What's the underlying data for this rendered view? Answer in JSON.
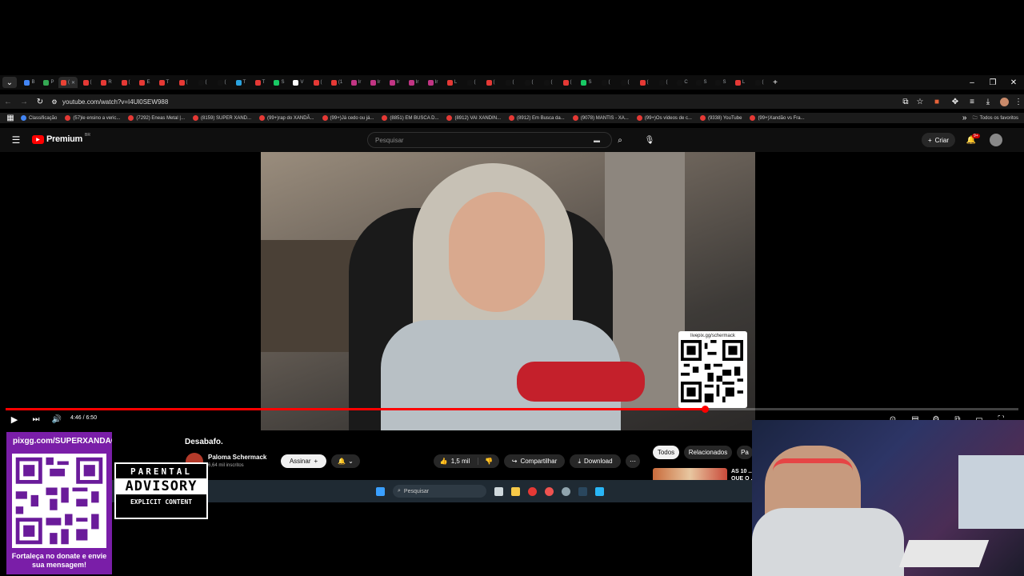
{
  "tabs": [
    {
      "title": "B",
      "color": "#4285f4"
    },
    {
      "title": "P",
      "color": "#34a853"
    },
    {
      "title": "(",
      "color": "#ea4335",
      "active": true
    },
    {
      "title": "(",
      "color": "#e53935"
    },
    {
      "title": "R",
      "color": "#e53935"
    },
    {
      "title": "(",
      "color": "#e53935"
    },
    {
      "title": "E",
      "color": "#e53935"
    },
    {
      "title": "T",
      "color": "#e53935"
    },
    {
      "title": "(",
      "color": "#e53935"
    },
    {
      "title": "(",
      "color": "#111"
    },
    {
      "title": "(",
      "color": "#111"
    },
    {
      "title": "T",
      "color": "#2aa3e0"
    },
    {
      "title": "T",
      "color": "#e53935"
    },
    {
      "title": "S",
      "color": "#18c964"
    },
    {
      "title": "V",
      "color": "#fff"
    },
    {
      "title": "(",
      "color": "#e53935"
    },
    {
      "title": "(1",
      "color": "#e53935"
    },
    {
      "title": "Ir",
      "color": "#c13584"
    },
    {
      "title": "Ir",
      "color": "#c13584"
    },
    {
      "title": "Ir",
      "color": "#c13584"
    },
    {
      "title": "Ir",
      "color": "#c13584"
    },
    {
      "title": "Ir",
      "color": "#c13584"
    },
    {
      "title": "L",
      "color": "#e53935"
    },
    {
      "title": "(",
      "color": "#111"
    },
    {
      "title": "(",
      "color": "#e53935"
    },
    {
      "title": "(",
      "color": "#111"
    },
    {
      "title": "(",
      "color": "#111"
    },
    {
      "title": "(",
      "color": "#111"
    },
    {
      "title": "(",
      "color": "#e53935"
    },
    {
      "title": "S",
      "color": "#18c964"
    },
    {
      "title": "(",
      "color": "#111"
    },
    {
      "title": "(",
      "color": "#111"
    },
    {
      "title": "(",
      "color": "#e53935"
    },
    {
      "title": "(",
      "color": "#111"
    },
    {
      "title": "C",
      "color": "#111"
    },
    {
      "title": "S",
      "color": "#111"
    },
    {
      "title": "S",
      "color": "#111"
    },
    {
      "title": "L",
      "color": "#e53935"
    },
    {
      "title": "(",
      "color": "#111"
    }
  ],
  "address": {
    "url": "youtube.com/watch?v=I4Ul0SEW988"
  },
  "bookmarks": [
    "Classificação",
    "(57)le ensino a veric...",
    "(7292) Eneas Metal |...",
    "(8159) SUPER XAND...",
    "(99+)rap do XANDÃ...",
    "(99+)Já cedo ou já...",
    "(8851) EM BUSCA D...",
    "(8912) VAI XANDIN...",
    "(8912) Em Busca da...",
    "(9078) MANTIS - XA...",
    "(99+)Os vídeos de c...",
    "(9338) YouTube",
    "(99+)Xandão vs Fra..."
  ],
  "bookmarks_all": "Todos os favoritos",
  "youtube": {
    "logo": "Premium",
    "region": "BR",
    "search_placeholder": "Pesquisar",
    "create": "Criar",
    "notif_count": "9+"
  },
  "video": {
    "qr_label": "livepix.gg/schermack",
    "time": "4:46 / 6:50",
    "progress": 0.69
  },
  "meta": {
    "title": "Desabafo.",
    "channel": "Paloma Schermack",
    "subs": "6,64 mil inscritos",
    "subscribe": "Assinar",
    "likes": "1,5 mil",
    "share": "Compartilhar",
    "download": "Download"
  },
  "chips": [
    "Todos",
    "Relacionados",
    "Pa"
  ],
  "related": {
    "title_line1": "AS 10 ...",
    "title_line2": "QUE O ..."
  },
  "taskbar": {
    "search": "Pesquisar"
  },
  "overlay": {
    "link": "pixgg.com/SUPERXANDAO",
    "advisory_line1": "PARENTAL",
    "advisory_line2": "ADVISORY",
    "advisory_line3": "EXPLICIT CONTENT",
    "cta": "Fortaleça no donate e envie sua mensagem!"
  }
}
